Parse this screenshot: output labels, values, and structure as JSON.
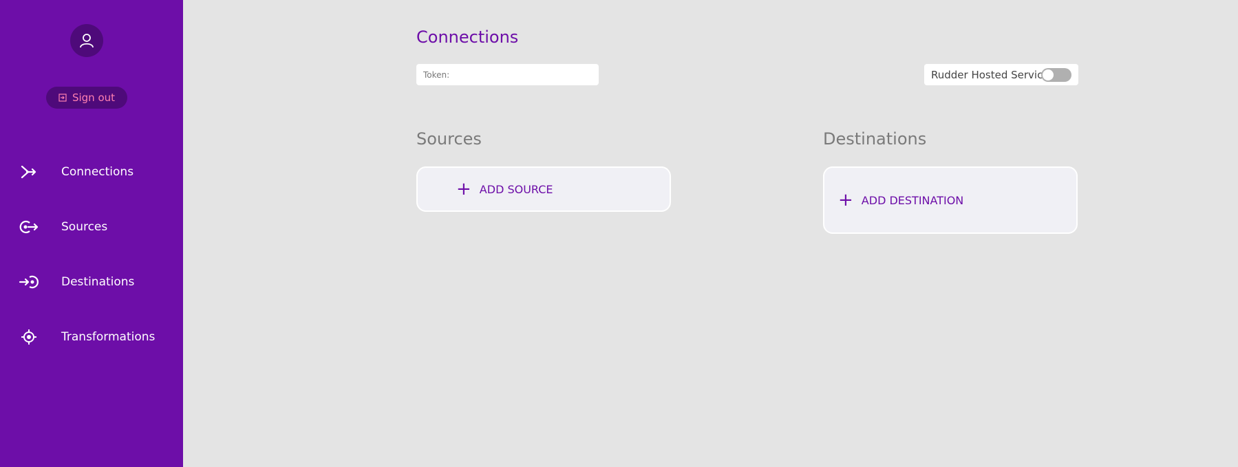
{
  "sidebar": {
    "signout_label": "Sign out",
    "items": [
      {
        "label": "Connections",
        "icon": "connections-icon"
      },
      {
        "label": "Sources",
        "icon": "sources-icon"
      },
      {
        "label": "Destinations",
        "icon": "destinations-icon"
      },
      {
        "label": "Transformations",
        "icon": "transformations-icon"
      }
    ]
  },
  "main": {
    "title": "Connections",
    "token_label": "Token:",
    "token_value": "",
    "hosted_label": "Rudder Hosted Service",
    "hosted_enabled": false,
    "sources_title": "Sources",
    "add_source_label": "ADD SOURCE",
    "destinations_title": "Destinations",
    "add_destination_label": "ADD DESTINATION"
  },
  "colors": {
    "sidebar_bg": "#6d0ea8",
    "accent": "#6d0ea8",
    "signout_text": "#ff80b0",
    "page_bg": "#e4e4e4"
  }
}
